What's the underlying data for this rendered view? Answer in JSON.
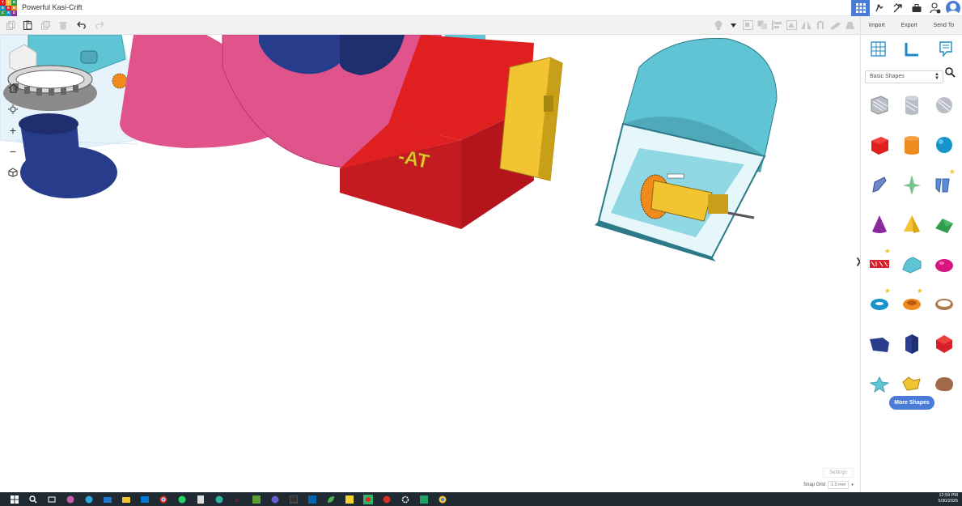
{
  "app": {
    "title": "Powerful Kasi-Crift",
    "logo_letters": [
      "T",
      "I",
      "N",
      "K",
      "E",
      "R",
      "C",
      "A",
      "D"
    ]
  },
  "toolbar": {
    "left_tools": [
      "copy-icon",
      "paste-icon",
      "duplicate-icon",
      "delete-icon",
      "undo-icon",
      "redo-icon"
    ],
    "right_tools": [
      "light-bulb-icon",
      "group-icon",
      "ungroup-icon",
      "align-icon",
      "flip-icon",
      "mirror-icon",
      "cruise-icon",
      "ruler-icon",
      "workplane-icon"
    ]
  },
  "panel": {
    "import_label": "Import",
    "export_label": "Export",
    "send_to_label": "Send To",
    "category": "Basic Shapes",
    "more_shapes_label": "More Shapes",
    "shapes": [
      {
        "name": "box-hole-shape",
        "color": "#b9bec6"
      },
      {
        "name": "cylinder-hole-shape",
        "color": "#b9bec6"
      },
      {
        "name": "sphere-hole-shape",
        "color": "#b9bec6"
      },
      {
        "name": "box-shape",
        "color": "#e02020"
      },
      {
        "name": "cylinder-shape",
        "color": "#ef8a1c"
      },
      {
        "name": "sphere-shape",
        "color": "#1794c9"
      },
      {
        "name": "scribble-shape",
        "color": "#6f86c9"
      },
      {
        "name": "graph-shape",
        "color": "#76c38c"
      },
      {
        "name": "text-shape",
        "color": "#5b8ed8"
      },
      {
        "name": "cone-shape",
        "color": "#8b2a9c"
      },
      {
        "name": "pyramid-shape",
        "color": "#f2c431"
      },
      {
        "name": "roof-shape",
        "color": "#2f9c4a"
      },
      {
        "name": "text-3d-shape",
        "color": "#d8202c"
      },
      {
        "name": "round-roof-shape",
        "color": "#5fc4d4"
      },
      {
        "name": "half-sphere-shape",
        "color": "#d6167c"
      },
      {
        "name": "torus-shape",
        "color": "#1794c9"
      },
      {
        "name": "tube-shape",
        "color": "#ef8a1c"
      },
      {
        "name": "ring-shape",
        "color": "#b07a4a"
      },
      {
        "name": "wedge-shape",
        "color": "#283c8c"
      },
      {
        "name": "polygon-shape",
        "color": "#2b3e92"
      },
      {
        "name": "icosahedron-shape",
        "color": "#d8202c"
      },
      {
        "name": "star-shape",
        "color": "#5fc4d4"
      },
      {
        "name": "heart-shape",
        "color": "#f2c431"
      },
      {
        "name": "rock-shape",
        "color": "#a0694a"
      }
    ]
  },
  "canvas": {
    "settings_label": "Settings",
    "snap_grid_label": "Snap Grid",
    "snap_grid_value": "1.0 mm",
    "visible_text": "-AT"
  },
  "taskbar": {
    "time": "12:59 PM",
    "date": "5/30/2026"
  },
  "colors": {
    "accent": "#4a7bd6",
    "workplane": "#e6f3fb",
    "pink": "#e0548b",
    "red": "#d8202c",
    "yellow": "#f2c431",
    "teal": "#5fc4d4",
    "navy": "#283c8c"
  }
}
